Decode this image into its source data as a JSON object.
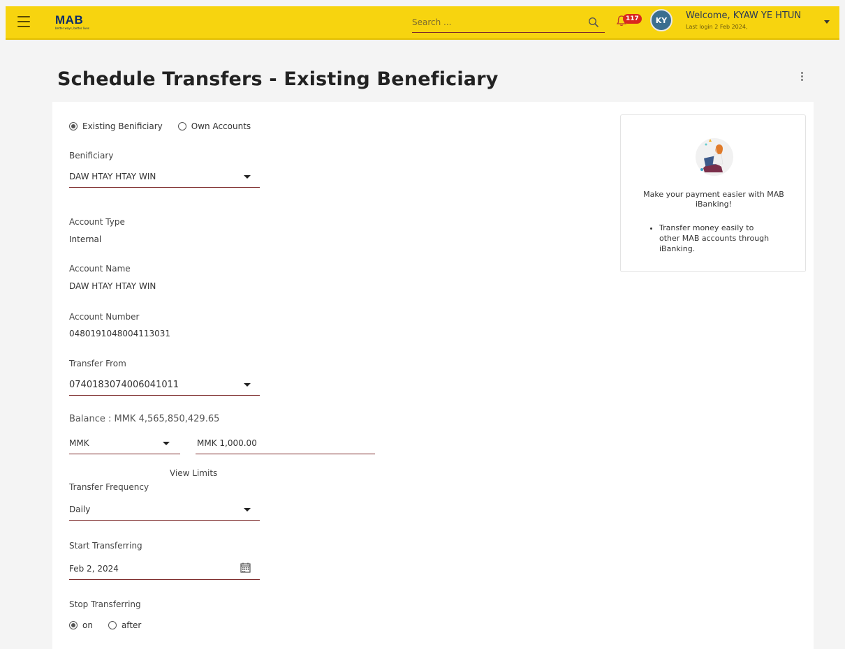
{
  "header": {
    "logo_text": "MAB",
    "logo_tagline": "better ways, better lives",
    "search_placeholder": "Search ...",
    "notification_count": "117",
    "avatar_initials": "KY",
    "welcome_text": "Welcome, KYAW YE HTUN",
    "last_login": "Last login 2 Feb 2024,",
    "accent_color": "#f7d40f",
    "icons": [
      "hamburger-icon",
      "search-icon",
      "bell-icon",
      "chevron-down-icon"
    ]
  },
  "page": {
    "title": "Schedule Transfers - Existing Beneficiary"
  },
  "form": {
    "beneficiary_type": {
      "options": [
        "Existing Benificiary",
        "Own Accounts"
      ],
      "selected": "Existing Benificiary"
    },
    "beneficiary": {
      "label": "Benificiary",
      "value": "DAW HTAY HTAY WIN"
    },
    "account_type": {
      "label": "Account Type",
      "value": "Internal"
    },
    "account_name": {
      "label": "Account Name",
      "value": "DAW HTAY HTAY WIN"
    },
    "account_number": {
      "label": "Account Number",
      "value": "0480191048004113031"
    },
    "transfer_from": {
      "label": "Transfer From",
      "value": "0740183074006041011"
    },
    "balance": "Balance : MMK 4,565,850,429.65",
    "currency": "MMK",
    "amount": "MMK 1,000.00",
    "view_limits": "View Limits",
    "frequency": {
      "label": "Transfer Frequency",
      "value": "Daily"
    },
    "start": {
      "label": "Start Transferring",
      "value": "Feb 2, 2024"
    },
    "stop": {
      "label": "Stop Transferring",
      "options": [
        "on",
        "after"
      ],
      "selected": "on"
    }
  },
  "promo": {
    "headline": "Make your payment easier with MAB iBanking!",
    "bullets": [
      "Transfer money easily to other MAB accounts through iBanking."
    ]
  }
}
